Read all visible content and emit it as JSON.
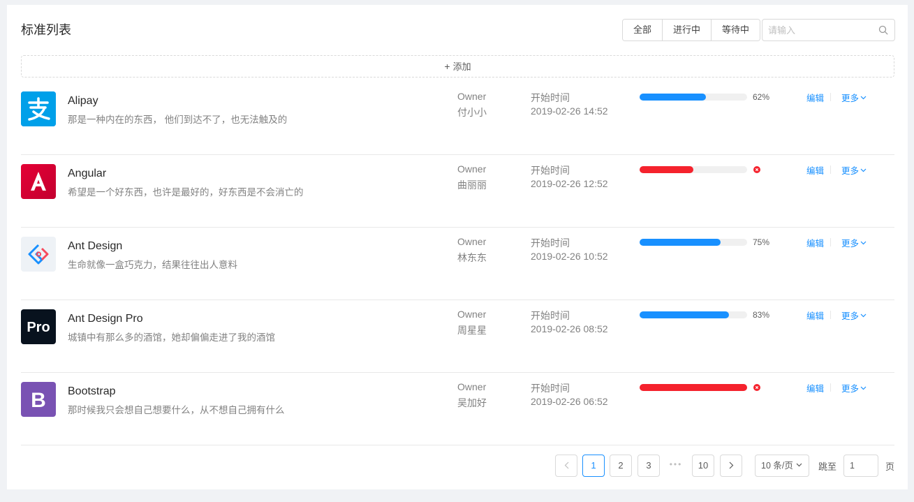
{
  "card": {
    "title": "标准列表"
  },
  "filter": {
    "options": [
      "全部",
      "进行中",
      "等待中"
    ]
  },
  "search": {
    "placeholder": "请输入"
  },
  "add_button": {
    "label": "添加"
  },
  "list": {
    "owner_label": "Owner",
    "time_label": "开始时间",
    "edit_label": "编辑",
    "more_label": "更多",
    "items": [
      {
        "title": "Alipay",
        "description": "那是一种内在的东西， 他们到达不了，也无法触及的",
        "owner": "付小小",
        "start_time": "2019-02-26 14:52",
        "progress": 62,
        "progress_text": "62%",
        "status": "active",
        "avatar": "alipay-logo",
        "color": "#1890ff"
      },
      {
        "title": "Angular",
        "description": "希望是一个好东西，也许是最好的，好东西是不会消亡的",
        "owner": "曲丽丽",
        "start_time": "2019-02-26 12:52",
        "progress": 50,
        "progress_text": "",
        "status": "exception",
        "avatar": "angular-logo",
        "color": "#f5222d"
      },
      {
        "title": "Ant Design",
        "description": "生命就像一盒巧克力，结果往往出人意料",
        "owner": "林东东",
        "start_time": "2019-02-26 10:52",
        "progress": 75,
        "progress_text": "75%",
        "status": "active",
        "avatar": "ant-design-logo",
        "color": "#1890ff"
      },
      {
        "title": "Ant Design Pro",
        "description": "城镇中有那么多的酒馆，她却偏偏走进了我的酒馆",
        "owner": "周星星",
        "start_time": "2019-02-26 08:52",
        "progress": 83,
        "progress_text": "83%",
        "status": "active",
        "avatar": "ant-design-pro-logo",
        "color": "#1890ff"
      },
      {
        "title": "Bootstrap",
        "description": "那时候我只会想自己想要什么，从不想自己拥有什么",
        "owner": "吴加好",
        "start_time": "2019-02-26 06:52",
        "progress": 100,
        "progress_text": "",
        "status": "exception",
        "avatar": "bootstrap-logo",
        "color": "#f5222d"
      }
    ]
  },
  "pagination": {
    "pages": [
      "1",
      "2",
      "3",
      "10"
    ],
    "current": "1",
    "ellipsis": "•••",
    "page_size": "10 条/页",
    "jump_label": "跳至",
    "jump_value": "1",
    "jump_suffix": "页"
  },
  "icons": {
    "prev": "chevron-left-icon",
    "next": "chevron-right-icon",
    "search": "search-icon",
    "more": "chevron-down-icon",
    "error": "close-circle-icon"
  },
  "colors": {
    "primary": "#1890ff",
    "exception": "#f5222d",
    "active_progress": "#1890ff"
  }
}
